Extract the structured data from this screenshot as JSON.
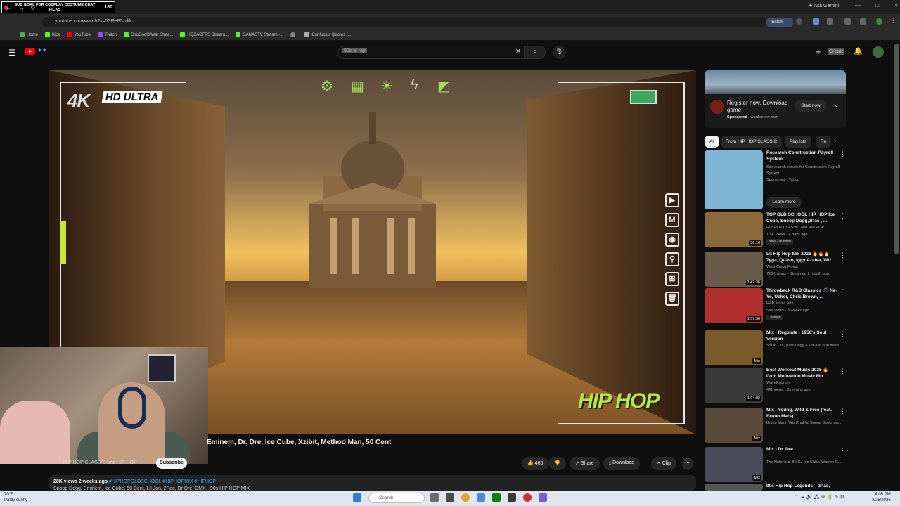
{
  "browser": {
    "tab_goal": "SUB GOAL FOR COSPLAY COSTUME CHAT PICKS",
    "tab_count": "180",
    "ask_gemini": "Ask Gemini",
    "url": "youtube.com/watch?v=53EeP5zdilc",
    "install": "Install",
    "bookmarks": [
      {
        "label": "Home",
        "color": "#4caf50"
      },
      {
        "label": "Kick",
        "color": "#53fc18"
      },
      {
        "label": "YouTube",
        "color": "#ff0000"
      },
      {
        "label": "Twitch",
        "color": "#9146ff"
      },
      {
        "label": "CiroGodOfWar Strea...",
        "color": "#53fc18"
      },
      {
        "label": "HQZACFPS Stream...",
        "color": "#53fc18"
      },
      {
        "label": "GANASTY Stream -...",
        "color": "#53fc18"
      },
      {
        "label": "",
        "color": "#888888"
      },
      {
        "label": "Confucius Quotes (...",
        "color": "#aaaaaa"
      }
    ]
  },
  "youtube": {
    "search_value": "90s ai rap",
    "create_label": "Create"
  },
  "video": {
    "hud_4k": "4K",
    "hud_hd": "HD ULTRA",
    "hud_hiphop": "HIP HOP",
    "title": "Eminem, Dr. Dre, Ice Cube, Xzibit, Method Man, 50 Cent",
    "channel": "HIP HOP CLASSIC and HIP HOP",
    "subscribe": "Subscribe",
    "likes": "465",
    "share": "Share",
    "download": "Download",
    "clip": "Clip",
    "views_age": "28K views  2 weeks ago",
    "tags": "#HIPHOPOLDSCHOOL #HIPHOPMIX #HIPHOP",
    "desc_line": "Snoop Dogg, Eminem, Ice Cube, 50 Cent, Lil Jon, 2Pac, Dr Dre, DMX - 90s HIP HOP MIX"
  },
  "sidebar": {
    "ad": {
      "title": "Register now. Download game",
      "sponsored": "Sponsored",
      "domain": "· warthunder.com",
      "cta": "Start now"
    },
    "chips": [
      "All",
      "From HIP HOP CLASSIC",
      "Playlists",
      "Re"
    ],
    "items": [
      {
        "title": "Research Construction Payroll System",
        "meta1": "See search results for Construction Payroll System",
        "meta2": "Sponsored · Yahoo",
        "cta": "Learn more",
        "duration": "",
        "thumb": "#7fb6d6"
      },
      {
        "title": "TOP OLD SCHOOL HIP HOP Ice Cube, Snoop Dogg,2Pac , ...",
        "meta1": "HIP HOP CLASSIC and HIP HOP",
        "meta2": "1.5K views · 4 days ago",
        "badge": "New · Dubbed",
        "duration": "56:16",
        "thumb": "#8a6a3a"
      },
      {
        "title": "Lit Hip Hop Mix 2026 🔥🔥🔥 Tyga, Quavo, Iggy Azalea, Wiz ...",
        "meta1": "West Coast Finest",
        "meta2": "720K views · Streamed 1 month ago",
        "duration": "1:42:36",
        "thumb": "#6a5a4a"
      },
      {
        "title": "Throwback R&B Classics 🎵 Ne-Yo, Usher, Chris Brown, ...",
        "meta1": "R&B Music Hits",
        "meta2": "53K views · 3 weeks ago",
        "badge": "Dubbed",
        "duration": "1:57:36",
        "thumb": "#b03030"
      },
      {
        "title": "Mix - Regulate - 1950's Soul Version",
        "meta1": "Sould Out, Nate Dogg, OutKast, and more",
        "meta2": "",
        "duration": "Mix",
        "thumb": "#7a5a2a"
      },
      {
        "title": "Best Workout Music 2025 🔥 Gym Motivation Music Mix ...",
        "meta1": "WaveRoamer",
        "meta2": "441 views · 3 months ago",
        "duration": "1:04:02",
        "thumb": "#3a3a3a"
      },
      {
        "title": "Mix - Young, Wild & Free (feat. Bruno Mars)",
        "meta1": "Bruno Mars, Wiz Khalifa, Snoop Dogg, an...",
        "meta2": "",
        "duration": "Mix",
        "thumb": "#5a4a3a"
      },
      {
        "title": "Mix - Dr. Dre",
        "meta1": "The Notorious B.I.G., Ice Cube, Warren G...",
        "meta2": "",
        "duration": "Mix",
        "thumb": "#4a4a5a"
      },
      {
        "title": "90s Hip Hop Legends – 2Pac,",
        "meta1": "",
        "meta2": "",
        "duration": "",
        "thumb": "#555555"
      }
    ]
  },
  "taskbar": {
    "weather_temp": "70°F",
    "weather_desc": "Partly sunny",
    "search": "Search",
    "time": "4:05 PM",
    "date": "3/25/2026"
  }
}
